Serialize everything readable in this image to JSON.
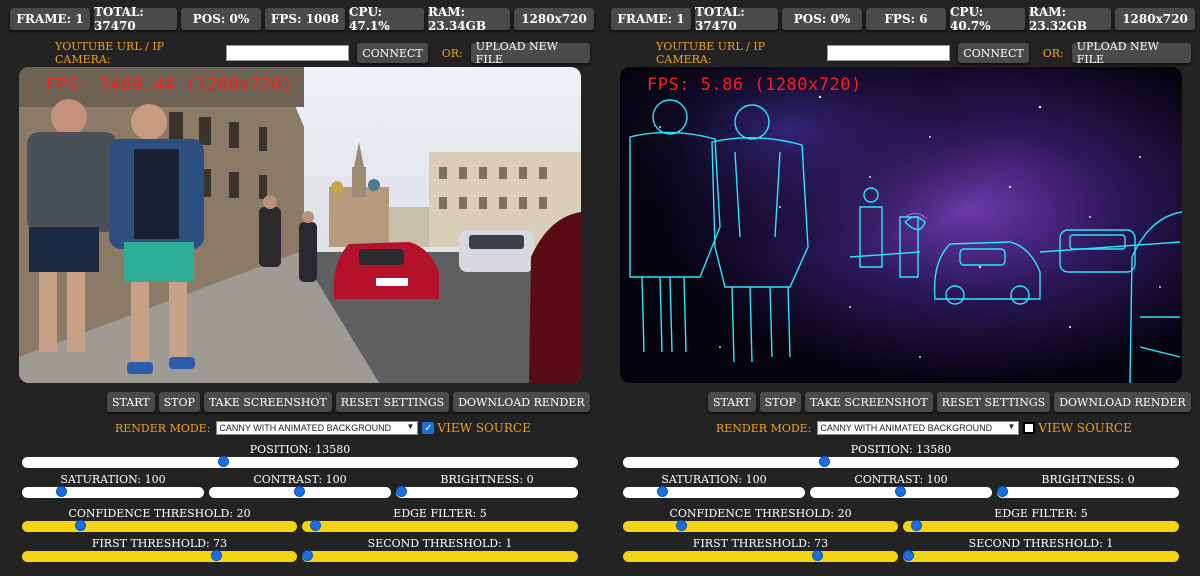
{
  "panels": [
    {
      "stats": {
        "frame": "FRAME: 1",
        "total": "TOTAL: 37470",
        "pos": "POS: 0%",
        "fps": "FPS: 1008",
        "cpu": "CPU: 47.1%",
        "ram": "RAM: 23.34GB",
        "res": "1280x720"
      },
      "url_label": "YOUTUBE URL / IP CAMERA:",
      "url_value": "",
      "connect": "CONNECT",
      "or": "OR:",
      "upload": "UPLOAD NEW FILE",
      "fps_overlay": "FPS: 3489.44 (1280x720)",
      "buttons": {
        "start": "START",
        "stop": "STOP",
        "screenshot": "TAKE SCREENSHOT",
        "reset": "RESET SETTINGS",
        "download": "DOWNLOAD RENDER"
      },
      "render_mode_label": "RENDER MODE:",
      "render_mode_value": "CANNY WITH ANIMATED BACKGROUND",
      "view_source_checked": true,
      "view_source": "VIEW SOURCE",
      "position_label": "POSITION: 13580",
      "position_level": 0.36,
      "saturation_label": "SATURATION: 100",
      "saturation_level": 0.2,
      "contrast_label": "CONTRAST: 100",
      "contrast_level": 0.5,
      "brightness_label": "BRIGHTNESS: 0",
      "brightness_level": 0.0,
      "confidence_label": "CONFIDENCE THRESHOLD: 20",
      "confidence_level": 0.2,
      "edge_label": "EDGE FILTER: 5",
      "edge_level": 0.03,
      "first_label": "FIRST THRESHOLD: 73",
      "first_level": 0.72,
      "second_label": "SECOND THRESHOLD: 1",
      "second_level": 0.0
    },
    {
      "stats": {
        "frame": "FRAME: 1",
        "total": "TOTAL: 37470",
        "pos": "POS: 0%",
        "fps": "FPS: 6",
        "cpu": "CPU: 40.7%",
        "ram": "RAM: 23.32GB",
        "res": "1280x720"
      },
      "url_label": "YOUTUBE URL / IP CAMERA:",
      "url_value": "",
      "connect": "CONNECT",
      "or": "OR:",
      "upload": "UPLOAD NEW FILE",
      "fps_overlay": "FPS: 5.86 (1280x720)",
      "buttons": {
        "start": "START",
        "stop": "STOP",
        "screenshot": "TAKE SCREENSHOT",
        "reset": "RESET SETTINGS",
        "download": "DOWNLOAD RENDER"
      },
      "render_mode_label": "RENDER MODE:",
      "render_mode_value": "CANNY WITH ANIMATED BACKGROUND",
      "view_source_checked": false,
      "view_source": "VIEW SOURCE",
      "position_label": "POSITION: 13580",
      "position_level": 0.36,
      "saturation_label": "SATURATION: 100",
      "saturation_level": 0.2,
      "contrast_label": "CONTRAST: 100",
      "contrast_level": 0.5,
      "brightness_label": "BRIGHTNESS: 0",
      "brightness_level": 0.0,
      "confidence_label": "CONFIDENCE THRESHOLD: 20",
      "confidence_level": 0.2,
      "edge_label": "EDGE FILTER: 5",
      "edge_level": 0.03,
      "first_label": "FIRST THRESHOLD: 73",
      "first_level": 0.72,
      "second_label": "SECOND THRESHOLD: 1",
      "second_level": 0.0
    }
  ],
  "colors": {
    "accent_orange": "#f0a020",
    "slider_yellow": "#f4d312",
    "thumb_blue": "#1a6fe0",
    "fps_red": "#ff1c1c",
    "canny_cyan": "#29e6ff"
  }
}
